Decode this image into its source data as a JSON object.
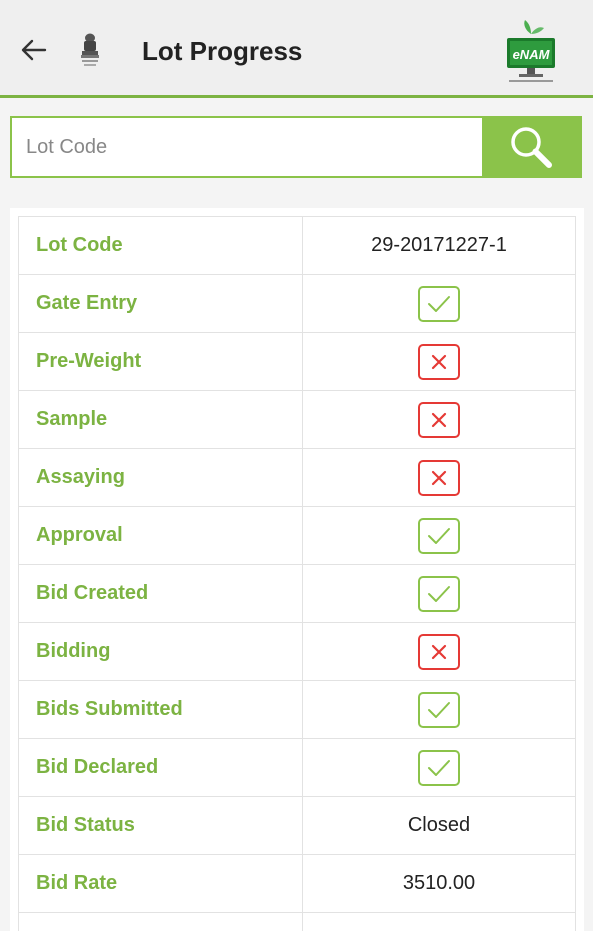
{
  "header": {
    "title": "Lot Progress",
    "logo_text": "eNAM",
    "back_icon": "arrow-left-icon",
    "emblem_icon": "national-emblem-icon",
    "accent_color": "#7cb342"
  },
  "search": {
    "placeholder": "Lot Code",
    "value": "",
    "button_icon": "search-icon"
  },
  "progress": {
    "rows": [
      {
        "label": "Lot Code",
        "type": "text",
        "value": "29-20171227-1"
      },
      {
        "label": "Gate Entry",
        "type": "status",
        "value": "done"
      },
      {
        "label": "Pre-Weight",
        "type": "status",
        "value": "not-done"
      },
      {
        "label": "Sample",
        "type": "status",
        "value": "not-done"
      },
      {
        "label": "Assaying",
        "type": "status",
        "value": "not-done"
      },
      {
        "label": "Approval",
        "type": "status",
        "value": "done"
      },
      {
        "label": "Bid Created",
        "type": "status",
        "value": "done"
      },
      {
        "label": "Bidding",
        "type": "status",
        "value": "not-done"
      },
      {
        "label": "Bids Submitted",
        "type": "status",
        "value": "done"
      },
      {
        "label": "Bid Declared",
        "type": "status",
        "value": "done"
      },
      {
        "label": "Bid Status",
        "type": "text",
        "value": "Closed"
      },
      {
        "label": "Bid Rate",
        "type": "text",
        "value": "3510.00"
      }
    ],
    "status_colors": {
      "done": "#8bc34a",
      "not-done": "#e53935"
    }
  }
}
